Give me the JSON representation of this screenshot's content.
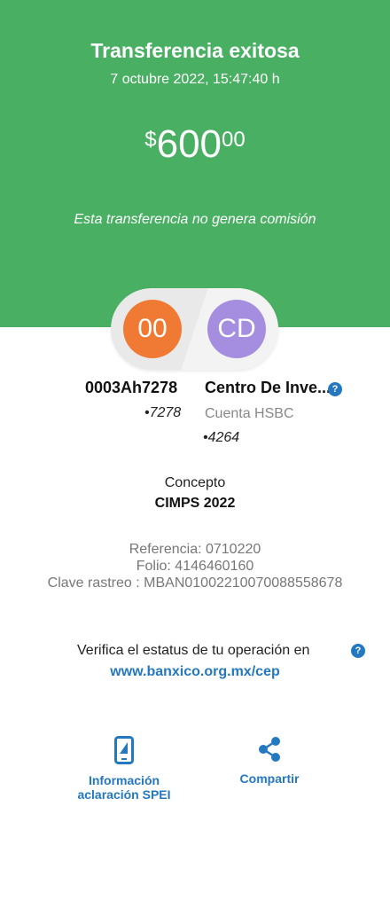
{
  "header": {
    "title": "Transferencia exitosa",
    "datetime": "7 octubre 2022, 15:47:40 h",
    "amount": {
      "currency": "$",
      "integer": "600",
      "decimals": "00"
    },
    "commission_note": "Esta transferencia no genera comisión"
  },
  "origin": {
    "avatar_initials": "00",
    "name": "0003Ah7278",
    "account_suffix": "•7278"
  },
  "destination": {
    "avatar_initials": "CD",
    "name": "Centro De Inve...",
    "bank": "Cuenta HSBC",
    "account_suffix": "•4264"
  },
  "concept": {
    "label": "Concepto",
    "value": "CIMPS 2022"
  },
  "references": {
    "referencia": "Referencia: 0710220",
    "folio": "Folio: 4146460160",
    "clave_rastreo": "Clave rastreo : MBAN01002210070088558678"
  },
  "verify": {
    "text": "Verifica el estatus de tu operación en",
    "link": "www.banxico.org.mx/cep"
  },
  "actions": {
    "spei_info_line1": "Información",
    "spei_info_line2": "aclaración SPEI",
    "share": "Compartir"
  },
  "icons": {
    "help": "question-mark-icon",
    "phone": "phone-icon",
    "share": "share-icon"
  },
  "colors": {
    "hero_green": "#49af62",
    "accent_blue": "#2478c0",
    "avatar_origin": "#f07a33",
    "avatar_destination": "#a58ee0"
  }
}
